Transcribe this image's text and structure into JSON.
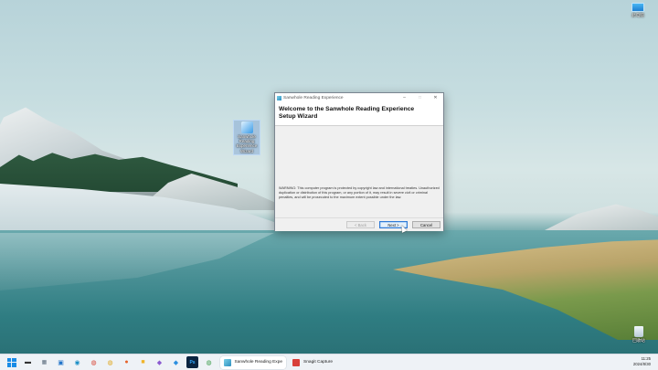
{
  "desktop": {
    "icons": {
      "computer": {
        "label": "此电脑",
        "icon": "computer-icon"
      },
      "recycle": {
        "label": "回收站",
        "icon": "recycle-bin-icon"
      },
      "setup": {
        "label": "Sanwhole Reading Experience Wizard",
        "icon": "installer-icon"
      }
    }
  },
  "dialog": {
    "title": "Sanwhole Reading Experience",
    "minimize": "–",
    "maximize": "□",
    "close": "✕",
    "heading": "Welcome to the Sanwhole Reading Experience Setup Wizard",
    "warning": "WARNING: This computer program is protected by copyright law and international treaties. Unauthorized duplication or distribution of this program, or any portion of it, may result in severe civil or criminal penalties, and will be prosecuted to the maximum extent possible under the law.",
    "buttons": {
      "back": "< Back",
      "next": "Next >",
      "cancel": "Cancel"
    }
  },
  "taskbar": {
    "apps": [
      {
        "label": "Sanwhole Reading Expe",
        "icon": "installer-icon",
        "active": true
      },
      {
        "label": "Snagit Capture",
        "icon": "snagit-icon",
        "active": false
      }
    ],
    "time": "11:25",
    "date": "2024/8/30",
    "colors": {
      "accent": "#1a8ce6"
    }
  }
}
